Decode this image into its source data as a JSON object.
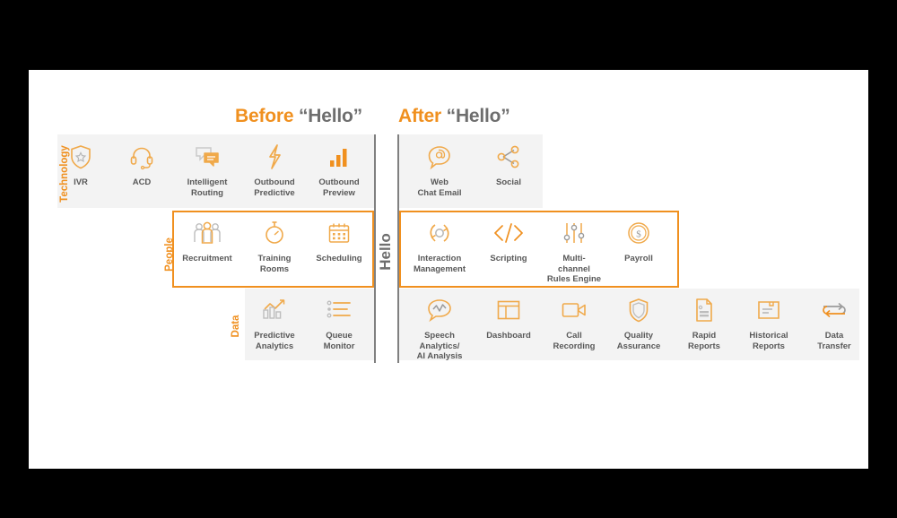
{
  "headings": {
    "before": {
      "accent": "Before",
      "rest": "“Hello”"
    },
    "after": {
      "accent": "After",
      "rest": "“Hello”"
    }
  },
  "axis_labels": {
    "technology": "Technology",
    "people": "People",
    "data": "Data"
  },
  "divider_label": "Hello",
  "colors": {
    "accent": "#f0901f",
    "text": "#585858",
    "band": "#f3f3f3",
    "divider": "#808080"
  },
  "rows": [
    {
      "name": "technology",
      "before": [
        {
          "label": "IVR",
          "icon": "shield-star-icon"
        },
        {
          "label": "ACD",
          "icon": "headset-icon"
        },
        {
          "label": "Intelligent\nRouting",
          "icon": "chat-bubbles-icon"
        },
        {
          "label": "Outbound\nPredictive",
          "icon": "lightning-bolt-icon"
        },
        {
          "label": "Outbound\nPreview",
          "icon": "bar-chart-icon"
        }
      ],
      "after": [
        {
          "label": "Web\nChat Email",
          "icon": "at-bubble-icon"
        },
        {
          "label": "Social",
          "icon": "share-network-icon"
        }
      ]
    },
    {
      "name": "people",
      "before": [
        {
          "label": "Recruitment",
          "icon": "people-group-icon"
        },
        {
          "label": "Training\nRooms",
          "icon": "stopwatch-icon"
        },
        {
          "label": "Scheduling",
          "icon": "calendar-icon"
        }
      ],
      "after": [
        {
          "label": "Interaction\nManagement",
          "icon": "refresh-cycle-icon"
        },
        {
          "label": "Scripting",
          "icon": "code-brackets-icon"
        },
        {
          "label": "Multi-\nchannel\nRules Engine",
          "icon": "sliders-icon"
        },
        {
          "label": "Payroll",
          "icon": "coin-dollar-icon"
        }
      ]
    },
    {
      "name": "data",
      "before": [
        {
          "label": "Predictive\nAnalytics",
          "icon": "analytics-chart-icon"
        },
        {
          "label": "Queue\nMonitor",
          "icon": "list-queue-icon"
        }
      ],
      "after": [
        {
          "label": "Speech\nAnalytics/\nAI Analysis",
          "icon": "speech-waveform-icon"
        },
        {
          "label": "Dashboard",
          "icon": "dashboard-panels-icon"
        },
        {
          "label": "Call\nRecording",
          "icon": "video-camera-icon"
        },
        {
          "label": "Quality\nAssurance",
          "icon": "shield-icon"
        },
        {
          "label": "Rapid\nReports",
          "icon": "document-report-icon"
        },
        {
          "label": "Historical\nReports",
          "icon": "document-folder-icon"
        },
        {
          "label": "Data\nTransfer",
          "icon": "exchange-arrows-icon"
        }
      ]
    }
  ]
}
